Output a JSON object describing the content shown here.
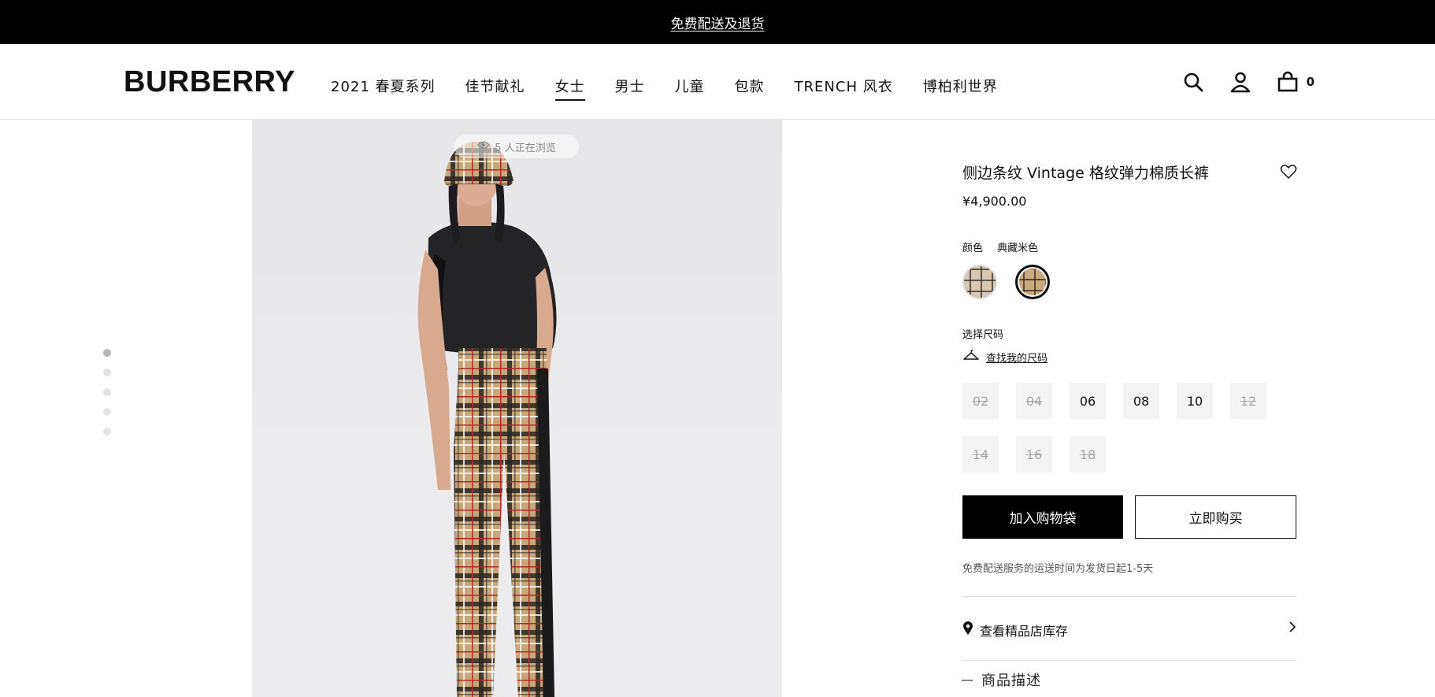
{
  "promo": {
    "text": "免费配送及退货"
  },
  "header": {
    "logo": "BURBERRY",
    "nav": [
      {
        "label": "2021 春夏系列"
      },
      {
        "label": "佳节献礼"
      },
      {
        "label": "女士",
        "active": true
      },
      {
        "label": "男士"
      },
      {
        "label": "儿童"
      },
      {
        "label": "包款"
      },
      {
        "label": "TRENCH 风衣"
      },
      {
        "label": "博柏利世界"
      }
    ],
    "icons": [
      "search-icon",
      "account-icon",
      "bag-icon"
    ],
    "bag_count": "0"
  },
  "gallery": {
    "dots_total": 5,
    "dots_active_index": 0,
    "viewers_text": "5 人正在浏览"
  },
  "product": {
    "title": "侧边条纹 Vintage 格纹弹力棉质长裤",
    "price": "¥4,900.00",
    "color_label": "颜色",
    "color_value": "典藏米色",
    "swatches": [
      {
        "name": "swatch-check-light",
        "selected": false
      },
      {
        "name": "swatch-archive-beige",
        "selected": true
      }
    ],
    "size_label": "选择尺码",
    "size_guide": "查找我的尺码",
    "sizes": [
      {
        "label": "02",
        "available": false
      },
      {
        "label": "04",
        "available": false
      },
      {
        "label": "06",
        "available": true
      },
      {
        "label": "08",
        "available": true
      },
      {
        "label": "10",
        "available": true
      },
      {
        "label": "12",
        "available": false
      },
      {
        "label": "14",
        "available": false
      },
      {
        "label": "16",
        "available": false
      },
      {
        "label": "18",
        "available": false
      }
    ],
    "add_to_bag": "加入购物袋",
    "buy_now": "立即购买",
    "shipping_note": "免费配送服务的运送时间为发货日起1-5天",
    "store_stock": "查看精品店库存",
    "description": "商品描述",
    "description_toggle": "一"
  },
  "colors": {
    "topbar_bg": "#000000",
    "primary_button_bg": "#000000",
    "size_bg": "#f4f4f4",
    "unavailable_text": "#a7a7a7"
  }
}
